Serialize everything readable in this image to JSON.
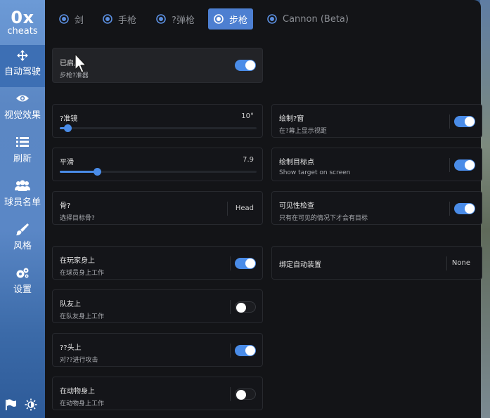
{
  "brand": {
    "line1": "0x",
    "line2": "cheats"
  },
  "sidebar": {
    "items": [
      {
        "icon": "move-arrows-icon",
        "label": "自动驾驶"
      },
      {
        "icon": "eye-icon",
        "label": "视觉效果"
      },
      {
        "icon": "list-icon",
        "label": "刷新"
      },
      {
        "icon": "users-icon",
        "label": "球员名单"
      },
      {
        "icon": "brush-icon",
        "label": "风格"
      },
      {
        "icon": "gears-icon",
        "label": "设置"
      }
    ],
    "bottom": {
      "left_icon": "flag-icon",
      "right_icon": "brightness-icon"
    }
  },
  "tabs": [
    "剑",
    "手枪",
    "?弹枪",
    "步枪",
    "Cannon (Beta)"
  ],
  "active_tab": "步枪",
  "left_column": {
    "enabled_card": {
      "title": "已启用",
      "subtitle": "步枪?准器",
      "toggle": true
    },
    "fov": {
      "title": "?准镜",
      "value": "10°",
      "level": 0.04
    },
    "smooth": {
      "title": "平滑",
      "value": "7.9",
      "level": 0.19
    },
    "bone": {
      "title": "骨?",
      "subtitle": "选择目标骨?",
      "value": "Head"
    },
    "on_players": {
      "title": "在玩家身上",
      "subtitle": "在球员身上工作",
      "toggle": true
    },
    "teammates": {
      "title": "队友上",
      "subtitle": "在队友身上工作",
      "toggle": false
    },
    "head": {
      "title": "??头上",
      "subtitle": "对??进行攻击",
      "toggle": true
    },
    "animals": {
      "title": "在动物身上",
      "subtitle": "在动物身上工作",
      "toggle": false
    }
  },
  "right_column": {
    "draw_window": {
      "title": "绘制?窗",
      "subtitle": "在?幕上显示视距",
      "toggle": true
    },
    "draw_target": {
      "title": "绘制目标点",
      "subtitle": "Show target on screen",
      "toggle": true
    },
    "visibility": {
      "title": "可见性检查",
      "subtitle": "只有在可见的情况下才会有目标",
      "toggle": true
    },
    "bind": {
      "title": "绑定自动装置",
      "value": "None"
    }
  },
  "colors": {
    "accent": "#4a8ce8",
    "panel": "#131417",
    "sidebar": "#5a87c6"
  }
}
